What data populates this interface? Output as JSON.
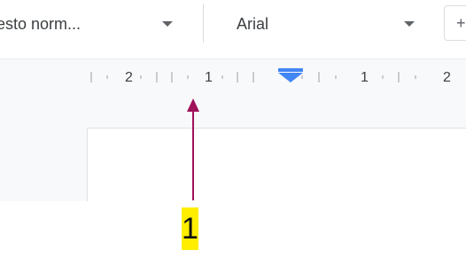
{
  "toolbar": {
    "style_select_value": "esto norm...",
    "font_select_value": "Arial",
    "font_size_glyph": "+"
  },
  "ruler": {
    "labels": [
      "2",
      "1",
      "1",
      "2"
    ],
    "indent_marker_color": "#4285f4"
  },
  "annotation": {
    "label": "1",
    "arrow_color": "#a0125a",
    "badge_color": "#ffee00"
  },
  "icons": {
    "style_dropdown": "chevron-down-icon",
    "font_dropdown": "chevron-down-icon",
    "first_line_indent": "indent-marker-icon",
    "annotation_arrow": "arrow-up-icon"
  }
}
